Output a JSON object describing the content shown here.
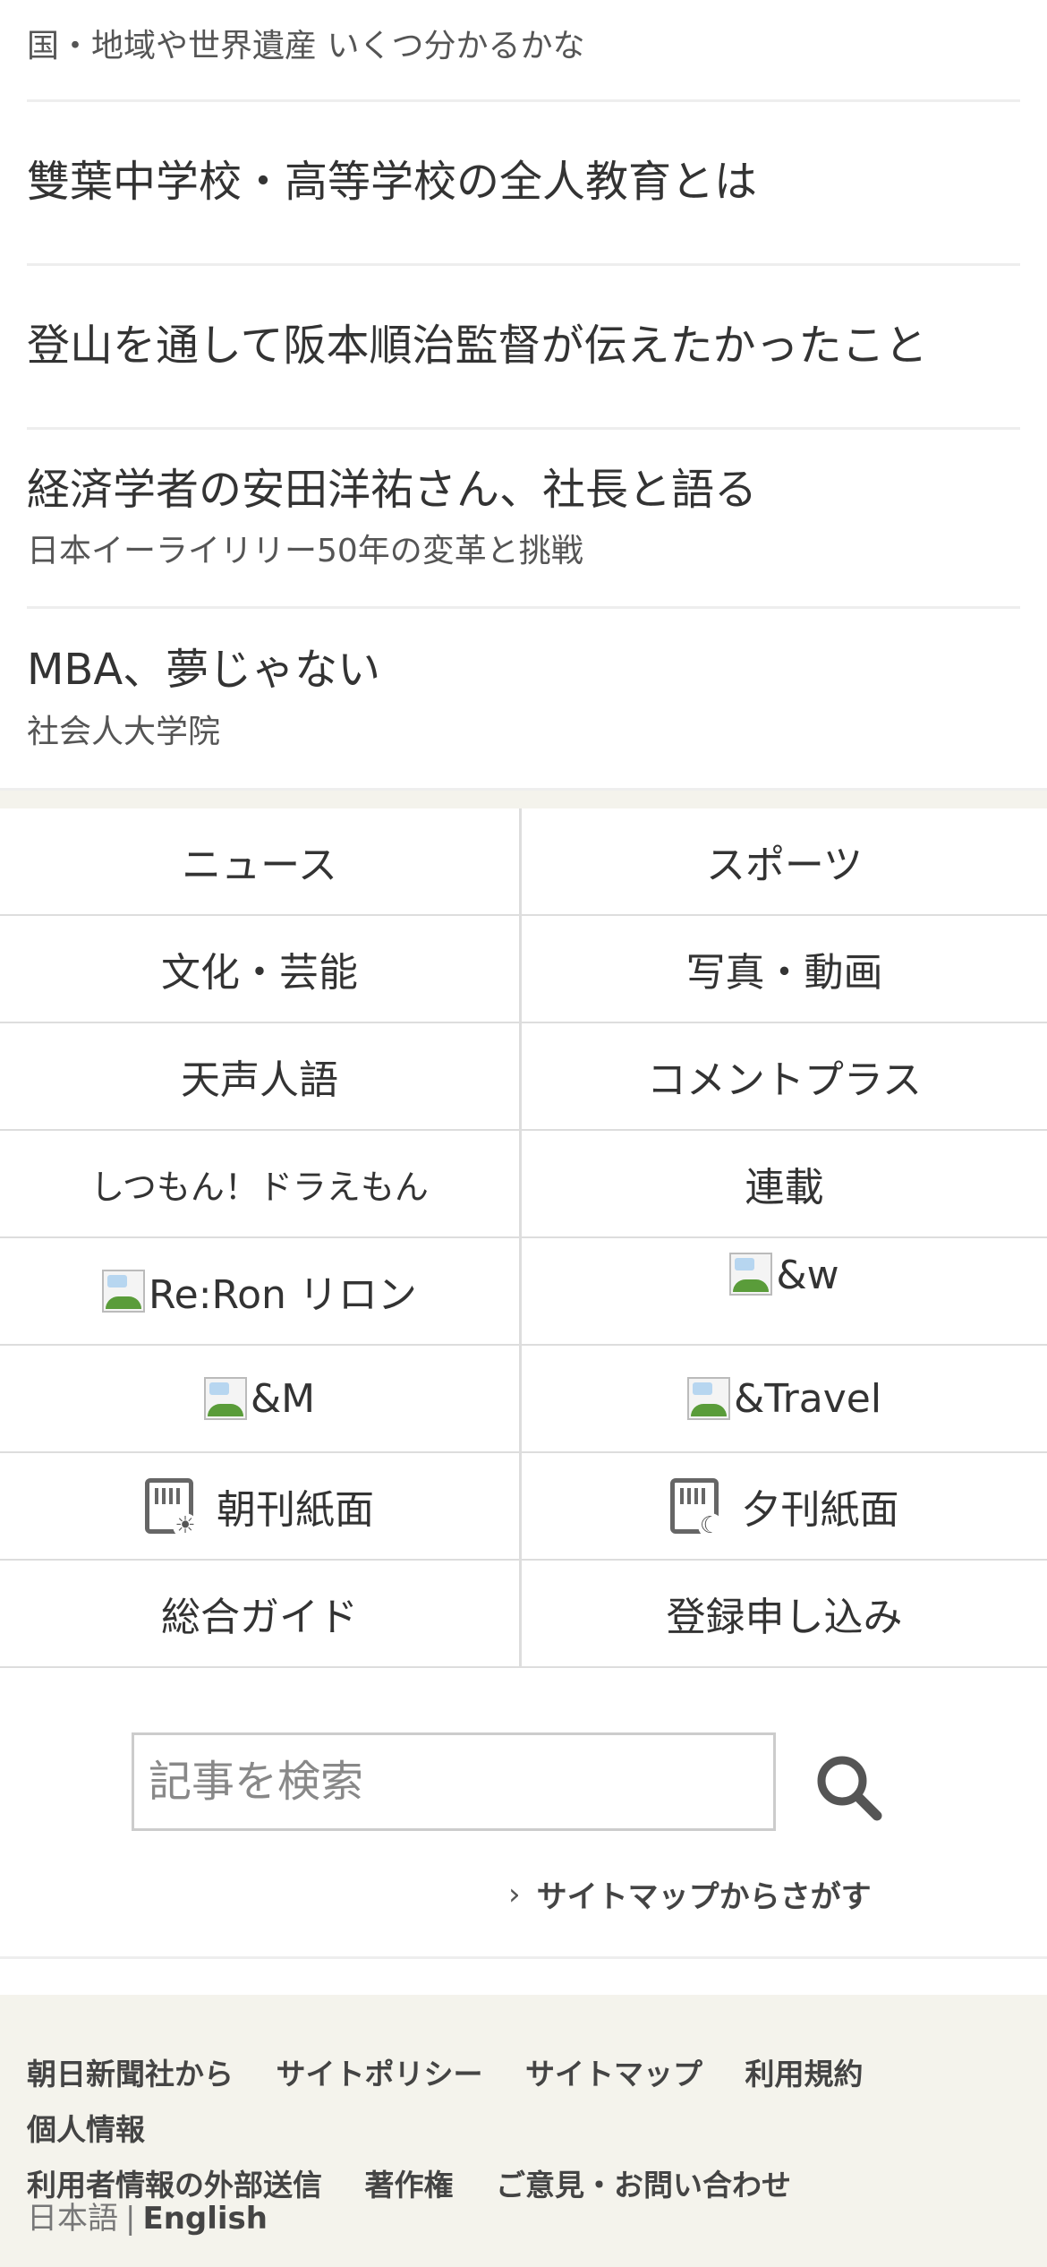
{
  "articles": [
    {
      "title": "",
      "sub": "国・地域や世界遺産 いくつ分かるかな"
    },
    {
      "title": "雙葉中学校・高等学校の全人教育とは",
      "sub": ""
    },
    {
      "title": "登山を通して阪本順治監督が伝えたかったこと",
      "sub": ""
    },
    {
      "title": "経済学者の安田洋祐さん、社長と語る",
      "sub": "日本イーライリリー50年の変革と挑戦"
    },
    {
      "title": "MBA、夢じゃない",
      "sub": "社会人大学院"
    }
  ],
  "nav": {
    "news": "ニュース",
    "sports": "スポーツ",
    "culture": "文化・芸能",
    "photo_video": "写真・動画",
    "tenseijingo": "天声人語",
    "comment_plus": "コメントプラス",
    "doraemon": "しつもん！ドラえもん",
    "serial": "連載",
    "reron": "Re:Ron リロン",
    "and_w": "&w",
    "and_m": "&M",
    "and_travel": "&Travel",
    "morning_paper": "朝刊紙面",
    "evening_paper": "夕刊紙面",
    "guide": "総合ガイド",
    "register": "登録申し込み"
  },
  "search": {
    "placeholder": "記事を検索",
    "sitemap_link": "サイトマップからさがす"
  },
  "footer": {
    "links": [
      "朝日新聞社から",
      "サイトポリシー",
      "サイトマップ",
      "利用規約",
      "個人情報",
      "利用者情報の外部送信",
      "著作権",
      "ご意見・お問い合わせ"
    ],
    "lang_ja": "日本語",
    "lang_sep": "|",
    "lang_en": "English"
  },
  "icons": {
    "search": "magnifier-icon",
    "chevron": "chevron-right-icon",
    "morning": "newspaper-sun-icon",
    "evening": "newspaper-moon-icon"
  },
  "colors": {
    "text": "#333333",
    "footer_bg": "#f4f3ec",
    "border": "#dddddd"
  }
}
